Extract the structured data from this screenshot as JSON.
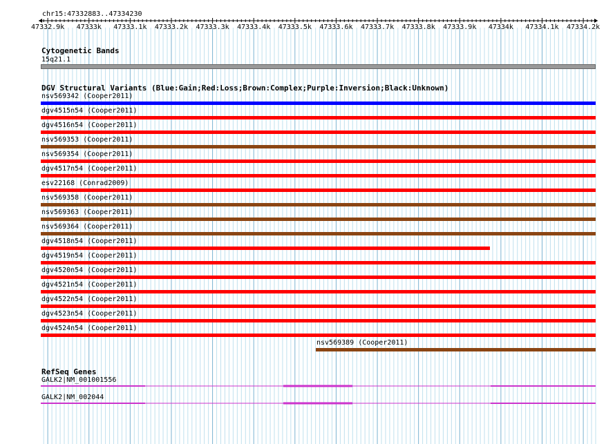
{
  "ruler": {
    "location": "chr15:47332883..47334230",
    "ticks": [
      "47332.9k",
      "47333k",
      "47333.1k",
      "47333.2k",
      "47333.3k",
      "47333.4k",
      "47333.5k",
      "47333.6k",
      "47333.7k",
      "47333.8k",
      "47333.9k",
      "47334k",
      "47334.1k",
      "47334.2k"
    ]
  },
  "tracks": {
    "cytoband": {
      "title": "Cytogenetic Bands",
      "band_label": "15q21.1",
      "color": "#999999"
    },
    "dgv": {
      "title": "DGV Structural Variants (Blue:Gain;Red:Loss;Brown:Complex;Purple:Inversion;Black:Unknown)",
      "colors": {
        "Gain": "#0000ff",
        "Loss": "#ff0000",
        "Complex": "#8b4513"
      },
      "features": [
        {
          "label": "nsv569342 (Cooper2011)",
          "type": "Gain",
          "start": 47332883,
          "end": 47334230
        },
        {
          "label": "dgv4515n54 (Cooper2011)",
          "type": "Loss",
          "start": 47332883,
          "end": 47334230
        },
        {
          "label": "dgv4516n54 (Cooper2011)",
          "type": "Loss",
          "start": 47332883,
          "end": 47334230
        },
        {
          "label": "nsv569353 (Cooper2011)",
          "type": "Complex",
          "start": 47332883,
          "end": 47334230
        },
        {
          "label": "nsv569354 (Cooper2011)",
          "type": "Loss",
          "start": 47332883,
          "end": 47334230
        },
        {
          "label": "dgv4517n54 (Cooper2011)",
          "type": "Loss",
          "start": 47332883,
          "end": 47334230
        },
        {
          "label": "esv22168 (Conrad2009)",
          "type": "Loss",
          "start": 47332883,
          "end": 47334230
        },
        {
          "label": "nsv569358 (Cooper2011)",
          "type": "Complex",
          "start": 47332883,
          "end": 47334230
        },
        {
          "label": "nsv569363 (Cooper2011)",
          "type": "Complex",
          "start": 47332883,
          "end": 47334230
        },
        {
          "label": "nsv569364 (Cooper2011)",
          "type": "Complex",
          "start": 47332883,
          "end": 47334230
        },
        {
          "label": "dgv4518n54 (Cooper2011)",
          "type": "Loss",
          "start": 47332883,
          "end": 47333973
        },
        {
          "label": "dgv4519n54 (Cooper2011)",
          "type": "Loss",
          "start": 47332883,
          "end": 47334230
        },
        {
          "label": "dgv4520n54 (Cooper2011)",
          "type": "Loss",
          "start": 47332883,
          "end": 47334230
        },
        {
          "label": "dgv4521n54 (Cooper2011)",
          "type": "Loss",
          "start": 47332883,
          "end": 47334230
        },
        {
          "label": "dgv4522n54 (Cooper2011)",
          "type": "Loss",
          "start": 47332883,
          "end": 47334230
        },
        {
          "label": "dgv4523n54 (Cooper2011)",
          "type": "Loss",
          "start": 47332883,
          "end": 47334230
        },
        {
          "label": "dgv4524n54 (Cooper2011)",
          "type": "Loss",
          "start": 47332883,
          "end": 47334230
        },
        {
          "label": "nsv569389 (Cooper2011)",
          "type": "Complex",
          "start": 47333550,
          "end": 47334230
        }
      ]
    },
    "refseq": {
      "title": "RefSeq Genes",
      "color": "#cc33cc",
      "genes": [
        {
          "label": "GALK2|NM_001001556"
        },
        {
          "label": "GALK2|NM_002044"
        }
      ]
    }
  }
}
